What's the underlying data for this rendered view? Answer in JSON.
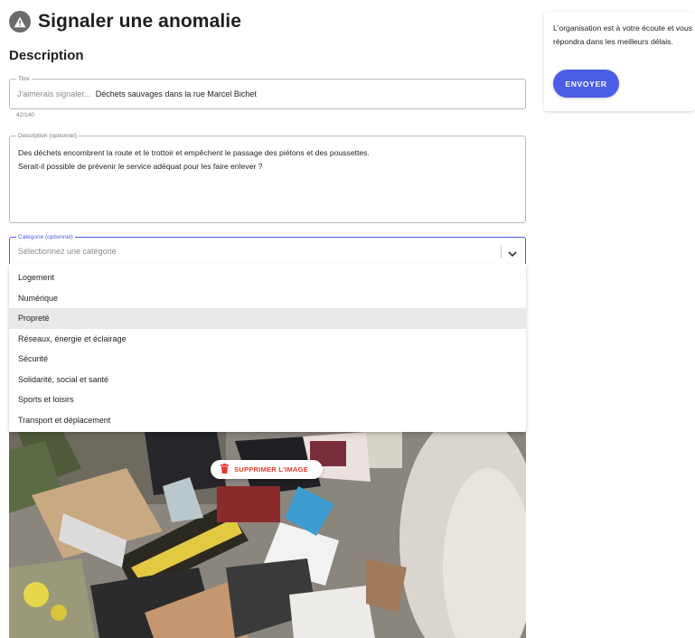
{
  "header": {
    "title": "Signaler une anomalie",
    "icon": "warning-icon"
  },
  "section_title": "Description",
  "title_field": {
    "legend": "Titre",
    "prefix": "J'aimerais signaler...",
    "value": "Déchets sauvages dans la rue Marcel Bichet",
    "counter": "42/140"
  },
  "description_field": {
    "legend": "Description (optionnel)",
    "line1": "Des déchets encombrent la route et le trottoir et empêchent le passage des piétons et des poussettes.",
    "line2": "Serait-il possible de prévenir le service adéquat pour les faire enlever ?"
  },
  "category_field": {
    "legend": "Catégorie (optionnel)",
    "placeholder": "Sélectionnez une catégorie",
    "options": [
      "Logement",
      "Numérique",
      "Propreté",
      "Réseaux, énergie et éclairage",
      "Sécurité",
      "Solidarité, social et santé",
      "Sports et loisirs",
      "Transport et déplacement"
    ],
    "highlighted": "Propreté"
  },
  "image": {
    "delete_label": "SUPPRIMER L'IMAGE"
  },
  "side_panel": {
    "text": "L'organisation est à votre écoute et vous répondra dans les meilleurs délais.",
    "send_label": "ENVOYER"
  },
  "colors": {
    "accent": "#4b5ce6",
    "danger": "#e03a2f",
    "highlight": "#e8e8e8"
  }
}
